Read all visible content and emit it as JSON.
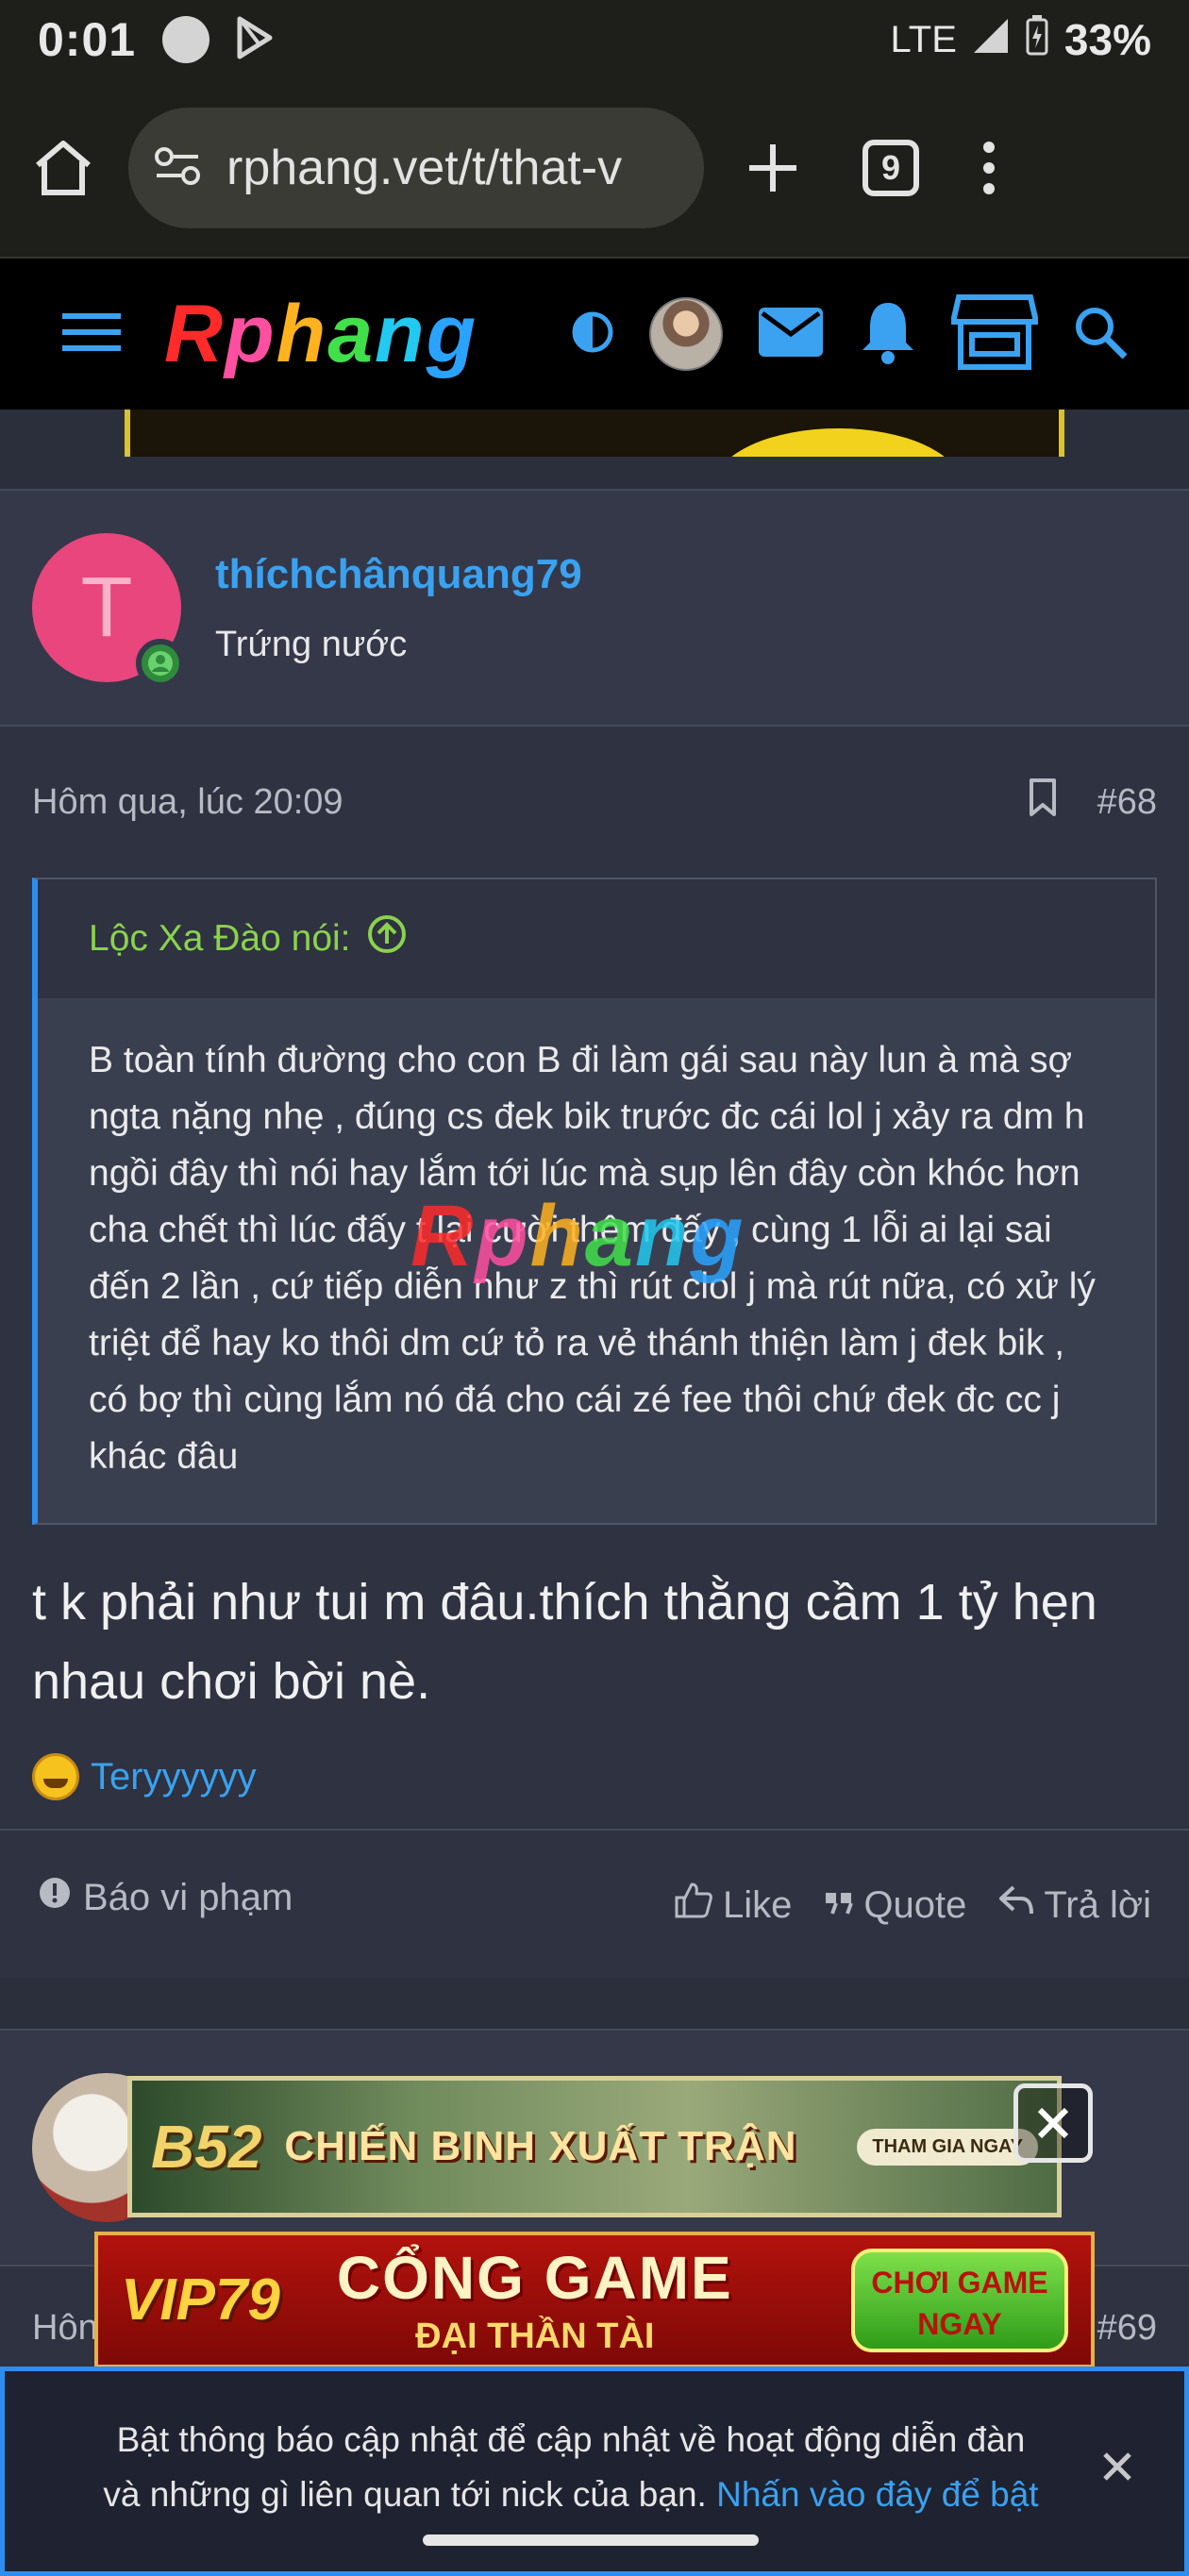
{
  "status_bar": {
    "time": "0:01",
    "network": "LTE",
    "battery": "33%"
  },
  "browser": {
    "url": "rphang.vet/t/that-v",
    "tab_count": "9"
  },
  "site": {
    "logo": "Rphang"
  },
  "post": {
    "author": "thíchchânquang79",
    "author_title": "Trứng nước",
    "avatar_letter": "T",
    "date": "Hôm qua, lúc 20:09",
    "number": "#68",
    "quote_author": "Lộc Xa Đào nói:",
    "quote_text": "B toàn tính đường cho con B đi làm gái sau này lun à mà sợ ngta nặng nhẹ , đúng cs đek bik trước đc cái lol j xảy ra dm h ngồi đây thì nói hay lắm tới lúc mà sụp lên đây còn khóc hơn cha chết thì lúc đấy t lại cười thêm đấy , cùng 1 lỗi ai lại sai đến 2 lần , cứ tiếp diễn như z thì rút clol j mà rút nữa, có xử lý triệt để hay ko thôi dm cứ tỏ ra vẻ thánh thiện làm j đek bik , có bợ thì cùng lắm nó đá cho cái zé fee thôi chứ đek đc cc j khác đâu",
    "body": "t k phải như tui m đâu.thích thằng cầm 1 tỷ hẹn nhau chơi bời nè.",
    "reaction_user": "Teryyyyyy",
    "actions": {
      "report": "Báo vi phạm",
      "like": "Like",
      "quote": "Quote",
      "reply": "Trả lời"
    }
  },
  "next_post": {
    "date_partial": "Hôn",
    "number": "#69"
  },
  "ads": {
    "ad1_brand": "B52",
    "ad1_title": "CHIẾN BINH XUẤT TRẬN",
    "ad1_cta": "THAM GIA NGAY",
    "ad2_brand": "VIP79",
    "ad2_title": "CỔNG GAME",
    "ad2_subtitle": "ĐẠI THẦN TÀI",
    "ad2_cta": "CHƠI GAME NGAY"
  },
  "notification": {
    "text": "Bật thông báo cập nhật để cập nhật về hoạt động diễn đàn và những gì liên quan tới nick của bạn.",
    "link": "Nhấn vào đây để bật"
  },
  "colors": {
    "accent_blue": "#3aa2f0",
    "quote_green": "#8bd24c",
    "avatar_pink": "#e8467c"
  }
}
